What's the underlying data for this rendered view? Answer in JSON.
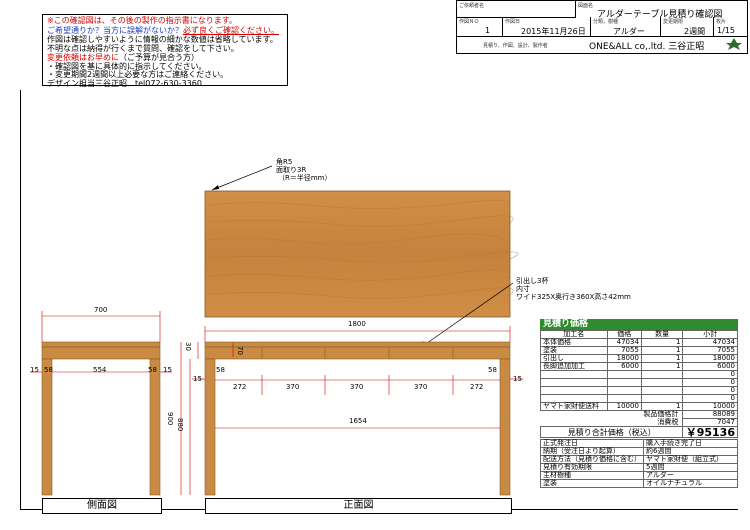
{
  "notes": {
    "line1": "※この確認図は、その後の製作の指示書になります。",
    "line2a": "ご希望通りか？当方に誤解がないか？",
    "line2b": "必ず良くご確認ください。",
    "line3": "作図は確認しやすいように情報の細かな数値は省略しています。",
    "line4": "不明な点は納得が行くまで質問、確認をして下さい。",
    "line5a": "変更依頼はお早めに",
    "line5b": "（ご予算が見合う方）",
    "line6": "・確認図を基に具体的に指示してください。",
    "line7": "・変更期間2週間以上必要な方はご連絡ください。",
    "line8": "デザイン担当三谷正昭　tel072-630-3360"
  },
  "titleblock": {
    "client_label": "ご依頼者名",
    "drawing_label": "図面名",
    "drawing_name": "アルダーテーブル見積り確認図",
    "no_label": "作図ＮＯ",
    "no_value": "1",
    "date_label": "作図日",
    "date_value": "2015年11月26日",
    "wood_label": "分類，樹種",
    "wood_value": "アルダー",
    "period_label": "変更期限",
    "period_value": "2週間",
    "page_label": "枚片",
    "page_value": "1/15",
    "sub_label": "見積り、作図、設計、製作者",
    "company": "ONE&ALL co,.ltd. 三谷正昭"
  },
  "drawing": {
    "top_note1": "角R5",
    "top_note2": "面取り3R",
    "top_note3": "（R＝半径mm）",
    "drawer_note1": "引出し3杯",
    "drawer_note2": "内寸",
    "drawer_note3": "ワイド325X奥行き360X高さ42mm",
    "side_width": "700",
    "side_inner": "554",
    "side_leg_l": "58",
    "side_leg_r": "58",
    "side_off_l": "15",
    "side_off_r": "15",
    "front_width": "1800",
    "front_top_h": "30",
    "front_apron_h": "70",
    "front_total_h": "900",
    "front_leg_h": "880",
    "front_leg_w": "58",
    "front_leg_w2": "58",
    "front_off_l": "15",
    "front_off_r": "15",
    "seg1": "272",
    "seg2": "370",
    "seg3": "370",
    "seg4": "370",
    "seg5": "272",
    "inner_span": "1654",
    "side_view_label": "側面図",
    "front_view_label": "正面図"
  },
  "estimate": {
    "header": "見積り価格",
    "col_name": "加工名",
    "col_price": "価格",
    "col_qty": "数量",
    "col_sub": "小計",
    "rows": [
      {
        "name": "本体価格",
        "price": "47034",
        "qty": "1",
        "sub": "47034"
      },
      {
        "name": "塗装",
        "price": "7055",
        "qty": "1",
        "sub": "7055"
      },
      {
        "name": "引出し",
        "price": "18000",
        "qty": "1",
        "sub": "18000"
      },
      {
        "name": "長脚追加加工",
        "price": "6000",
        "qty": "1",
        "sub": "6000"
      },
      {
        "name": "",
        "price": "",
        "qty": "",
        "sub": "0"
      },
      {
        "name": "",
        "price": "",
        "qty": "",
        "sub": "0"
      },
      {
        "name": "",
        "price": "",
        "qty": "",
        "sub": "0"
      },
      {
        "name": "",
        "price": "",
        "qty": "",
        "sub": "0"
      },
      {
        "name": "ヤマト家財便送料",
        "price": "10000",
        "qty": "1",
        "sub": "10000"
      }
    ],
    "product_total_label": "製品価格計",
    "product_total": "88089",
    "tax_label": "消費税",
    "tax": "7047",
    "total_label": "見積り合計価格（税込）",
    "total": "￥95136",
    "info": [
      {
        "k": "正式発注日",
        "v": "購入手続き完了日"
      },
      {
        "k": "納期（受注日より起算）",
        "v": "約6週間"
      },
      {
        "k": "配送方法（見積り価格に含む）",
        "v": "ヤマト家財便（組立式）"
      },
      {
        "k": "見積り有効期限",
        "v": "5週間"
      },
      {
        "k": "主材樹種",
        "v": "アルダー"
      },
      {
        "k": "塗装",
        "v": "オイルナチュラル"
      }
    ]
  },
  "colors": {
    "wood": "#c98a44",
    "wood_dark": "#a86a2c",
    "accent_green": "#2e8b2e",
    "red": "#d40000",
    "blue": "#1a3cc8"
  }
}
